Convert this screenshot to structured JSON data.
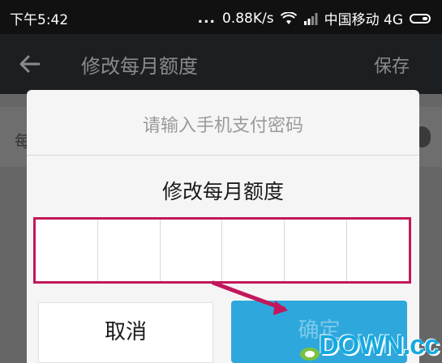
{
  "status_bar": {
    "time": "下午5:42",
    "dots": "...",
    "speed": "0.88K/s",
    "carrier": "中国移动 4G"
  },
  "app_bar": {
    "title": "修改每月额度",
    "save_label": "保存"
  },
  "background_row": {
    "partial_char": "每"
  },
  "dialog": {
    "title": "请输入手机支付密码",
    "subtitle": "修改每月额度",
    "cancel_label": "取消",
    "confirm_label": "确定",
    "password_cells": 6
  },
  "watermark": {
    "text": "DOWN.cc"
  },
  "colors": {
    "accent": "#2ea8dc",
    "highlight": "#c2185b"
  }
}
